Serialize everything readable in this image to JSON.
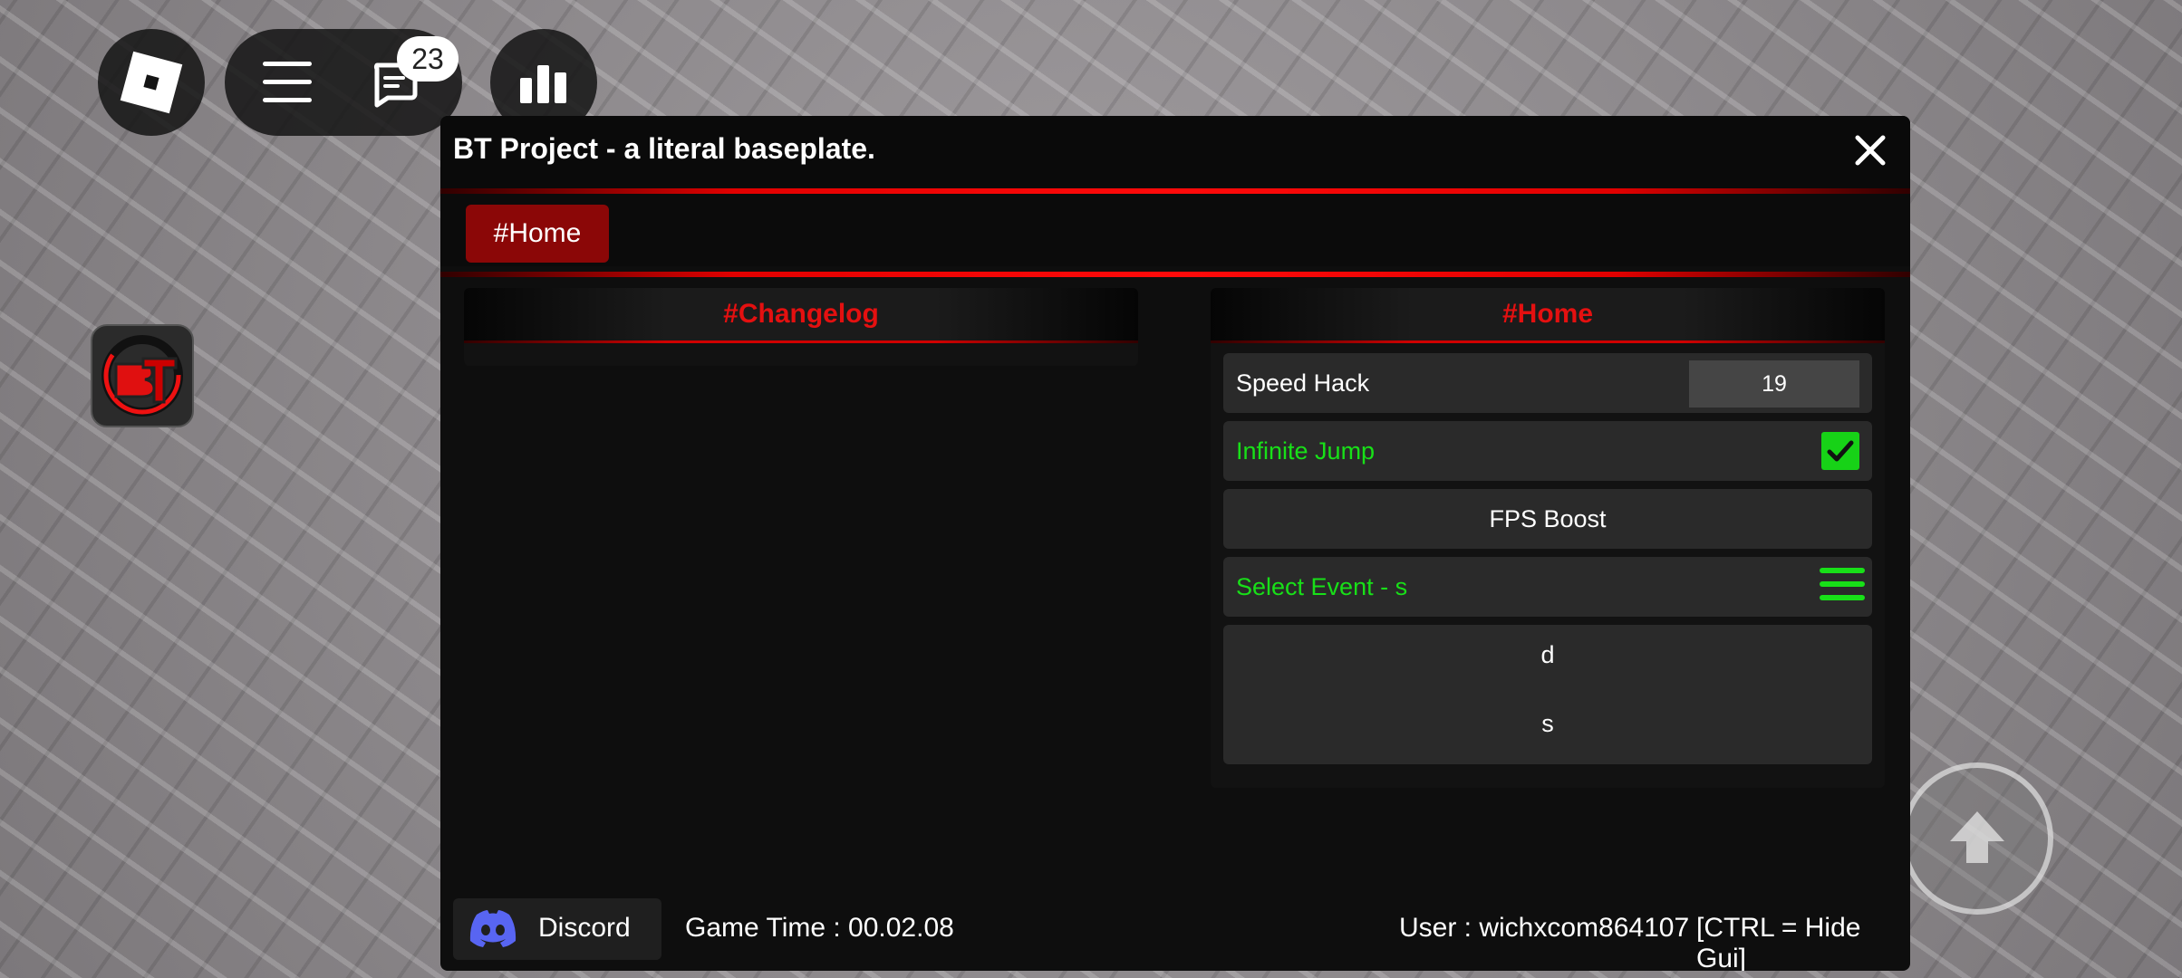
{
  "topbar": {
    "chat_badge_count": "23"
  },
  "window": {
    "title": "BT Project - a literal baseplate.",
    "tabs": [
      {
        "label": "#Home",
        "selected": true
      }
    ],
    "left_panel": {
      "title": "#Changelog"
    },
    "right_panel": {
      "title": "#Home",
      "speed_hack": {
        "label": "Speed Hack",
        "value": "19"
      },
      "infinite_jump": {
        "label": "Infinite Jump",
        "checked": true
      },
      "fps_boost": {
        "label": "FPS Boost"
      },
      "select_event": {
        "label": "Select Event - s",
        "options": [
          "d",
          "s"
        ]
      }
    },
    "footer": {
      "discord_label": "Discord",
      "game_time": "Game Time : 00.02.08",
      "user": "User : wichxcom864107",
      "hint": "[CTRL = Hide Gui]"
    }
  },
  "colors": {
    "accent_red": "#e10000",
    "tab_active": "#8b0707",
    "active_green": "#18e018",
    "discord_blurple": "#5865f2"
  },
  "icons": [
    "roblox-logo-icon",
    "menu-icon",
    "chat-icon",
    "leaderboard-icon",
    "bt-logo-icon",
    "close-icon",
    "check-icon",
    "list-icon",
    "discord-icon",
    "jump-arrow-icon"
  ]
}
